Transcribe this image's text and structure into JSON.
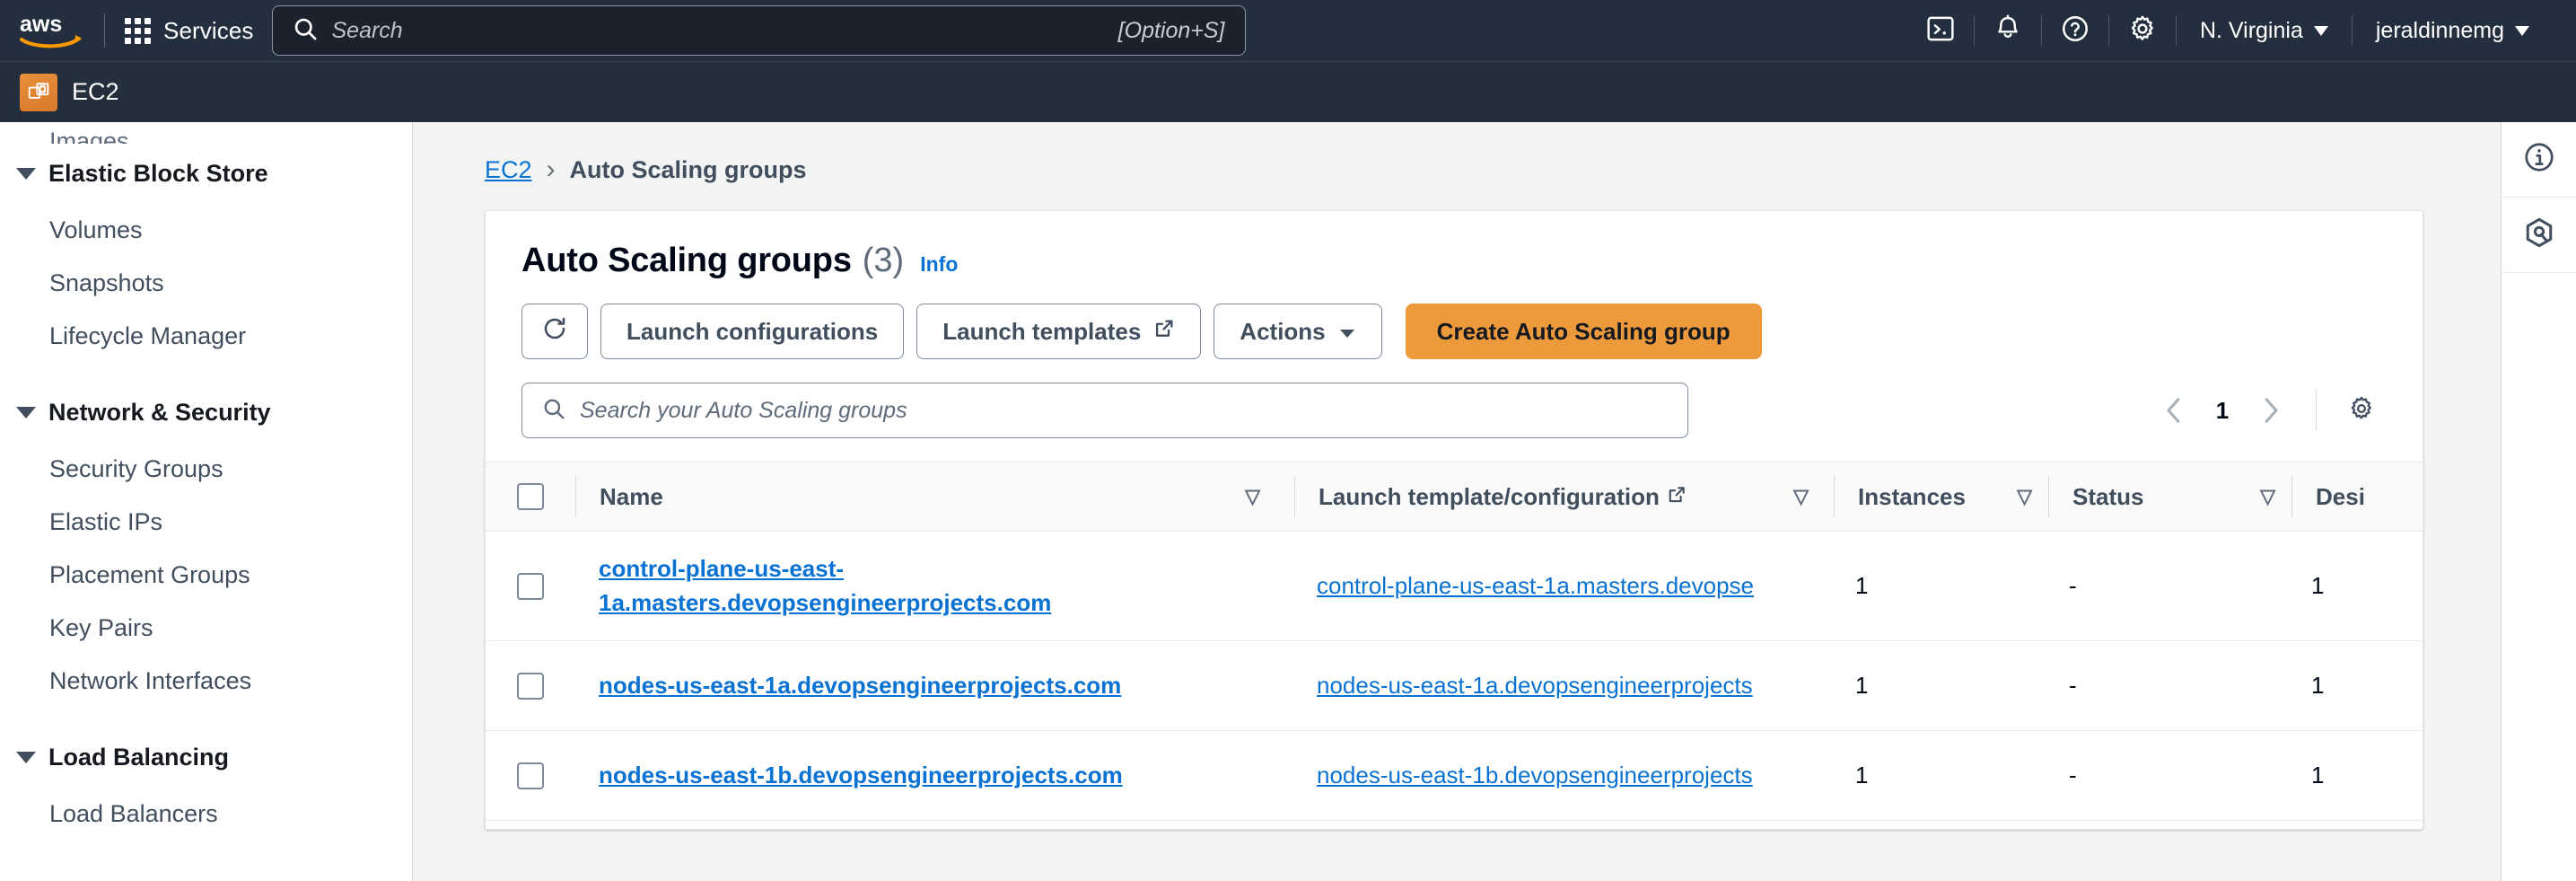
{
  "topnav": {
    "logo_alt": "aws",
    "services_label": "Services",
    "search": {
      "placeholder": "Search",
      "value": "",
      "shortcut": "[Option+S]"
    },
    "icons": [
      {
        "name": "cloudshell-icon",
        "title": "CloudShell"
      },
      {
        "name": "notifications-bell-icon",
        "title": "Notifications"
      },
      {
        "name": "help-question-icon",
        "title": "Help"
      },
      {
        "name": "settings-gear-icon",
        "title": "Settings"
      }
    ],
    "region_label": "N. Virginia",
    "account_label": "jeraldinnemg"
  },
  "servicebar": {
    "service_name": "EC2",
    "icon": "ec2-service-icon"
  },
  "sidebar": {
    "clipped_top_item": "Images",
    "groups": [
      {
        "label": "Elastic Block Store",
        "expanded": true,
        "items": [
          "Volumes",
          "Snapshots",
          "Lifecycle Manager"
        ]
      },
      {
        "label": "Network & Security",
        "expanded": true,
        "items": [
          "Security Groups",
          "Elastic IPs",
          "Placement Groups",
          "Key Pairs",
          "Network Interfaces"
        ]
      },
      {
        "label": "Load Balancing",
        "expanded": true,
        "items": [
          "Load Balancers"
        ]
      }
    ]
  },
  "breadcrumb": {
    "root": "EC2",
    "separator": "›",
    "current": "Auto Scaling groups"
  },
  "card": {
    "title": "Auto Scaling groups",
    "count": "(3)",
    "info_label": "Info",
    "buttons": {
      "refresh": "refresh-icon",
      "launch_configurations": "Launch configurations",
      "launch_templates": "Launch templates",
      "actions": "Actions",
      "create": "Create Auto Scaling group"
    },
    "search": {
      "placeholder": "Search your Auto Scaling groups",
      "value": ""
    },
    "pagination": {
      "prev": "‹",
      "page": "1",
      "next": "›",
      "prefs": "preferences-gear-icon"
    }
  },
  "table": {
    "columns": [
      {
        "key": "name",
        "label": "Name",
        "sortable": true
      },
      {
        "key": "launch_template",
        "label": "Launch template/configuration",
        "sortable": true,
        "external": true
      },
      {
        "key": "instances",
        "label": "Instances",
        "sortable": true
      },
      {
        "key": "status",
        "label": "Status",
        "sortable": true
      },
      {
        "key": "desired",
        "label": "Desi",
        "sortable": false
      }
    ],
    "rows": [
      {
        "name": "control-plane-us-east-1a.masters.devopsengineerprojects.com",
        "launch_template": "control-plane-us-east-1a.masters.devopse",
        "instances": "1",
        "status": "-",
        "desired": "1"
      },
      {
        "name": "nodes-us-east-1a.devopsengineerprojects.com",
        "launch_template": "nodes-us-east-1a.devopsengineerprojects",
        "instances": "1",
        "status": "-",
        "desired": "1"
      },
      {
        "name": "nodes-us-east-1b.devopsengineerprojects.com",
        "launch_template": "nodes-us-east-1b.devopsengineerprojects",
        "instances": "1",
        "status": "-",
        "desired": "1"
      }
    ]
  },
  "rail": [
    {
      "name": "info-panel-icon",
      "title": "Info"
    },
    {
      "name": "amazon-q-icon",
      "title": "Amazon Q"
    }
  ],
  "colors": {
    "navbar": "#232f3e",
    "accent_orange": "#ec9a3c",
    "link_blue": "#0972d3",
    "page_bg": "#f2f3f3"
  }
}
